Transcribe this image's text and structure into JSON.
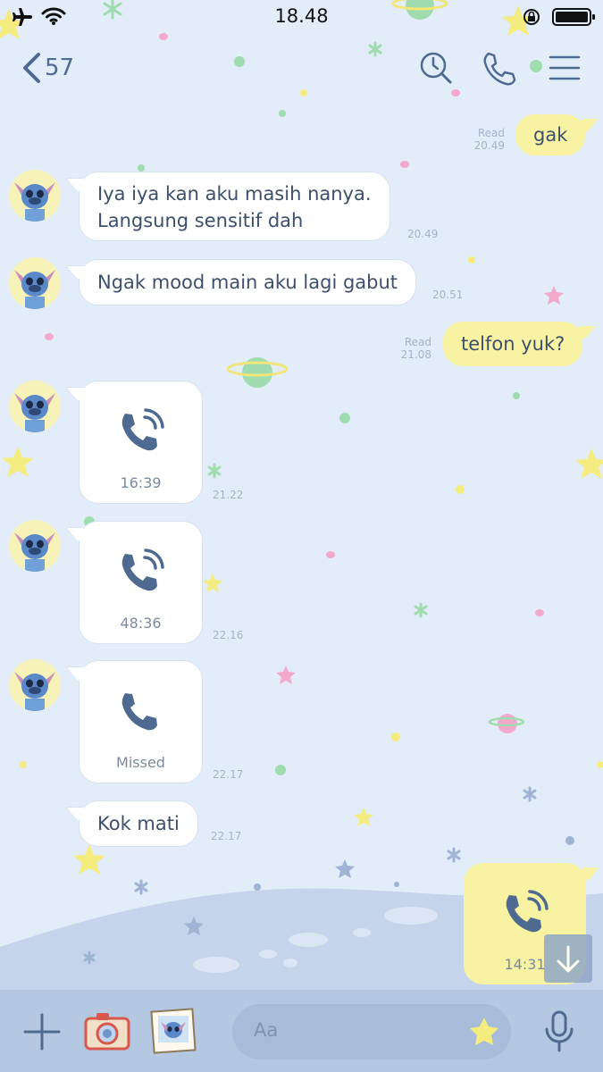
{
  "status_bar": {
    "time": "18.48"
  },
  "header": {
    "back_count": "57"
  },
  "messages": {
    "m1": {
      "text": "gak",
      "read": "Read",
      "time": "20.49"
    },
    "m2": {
      "line1": "Iya iya kan aku masih nanya.",
      "line2": "Langsung sensitif dah",
      "time": "20.49"
    },
    "m3": {
      "text": "Ngak mood main aku lagi gabut",
      "time": "20.51"
    },
    "m4": {
      "text": "telfon yuk?",
      "read": "Read",
      "time": "21.08"
    },
    "c1": {
      "label": "16:39",
      "time": "21.22"
    },
    "c2": {
      "label": "48:36",
      "time": "22.16"
    },
    "c3": {
      "label": "Missed",
      "time": "22.17"
    },
    "m5": {
      "text": "Kok mati",
      "time": "22.17"
    },
    "c4": {
      "label": "14:31"
    }
  },
  "composer": {
    "placeholder": "Aa"
  },
  "colors": {
    "accent": "#4f6a91",
    "bubble_out": "#f7f3a3",
    "bubble_in": "#ffffff",
    "background": "#e3edf9"
  },
  "icons": [
    "airplane-icon",
    "wifi-icon",
    "rotation-lock-icon",
    "battery-icon",
    "back-chevron-icon",
    "clock-search-icon",
    "phone-icon",
    "menu-icon",
    "phone-call-icon",
    "phone-missed-icon",
    "plus-icon",
    "camera-icon",
    "photo-icon",
    "star-icon",
    "mic-icon",
    "arrow-down-icon"
  ]
}
